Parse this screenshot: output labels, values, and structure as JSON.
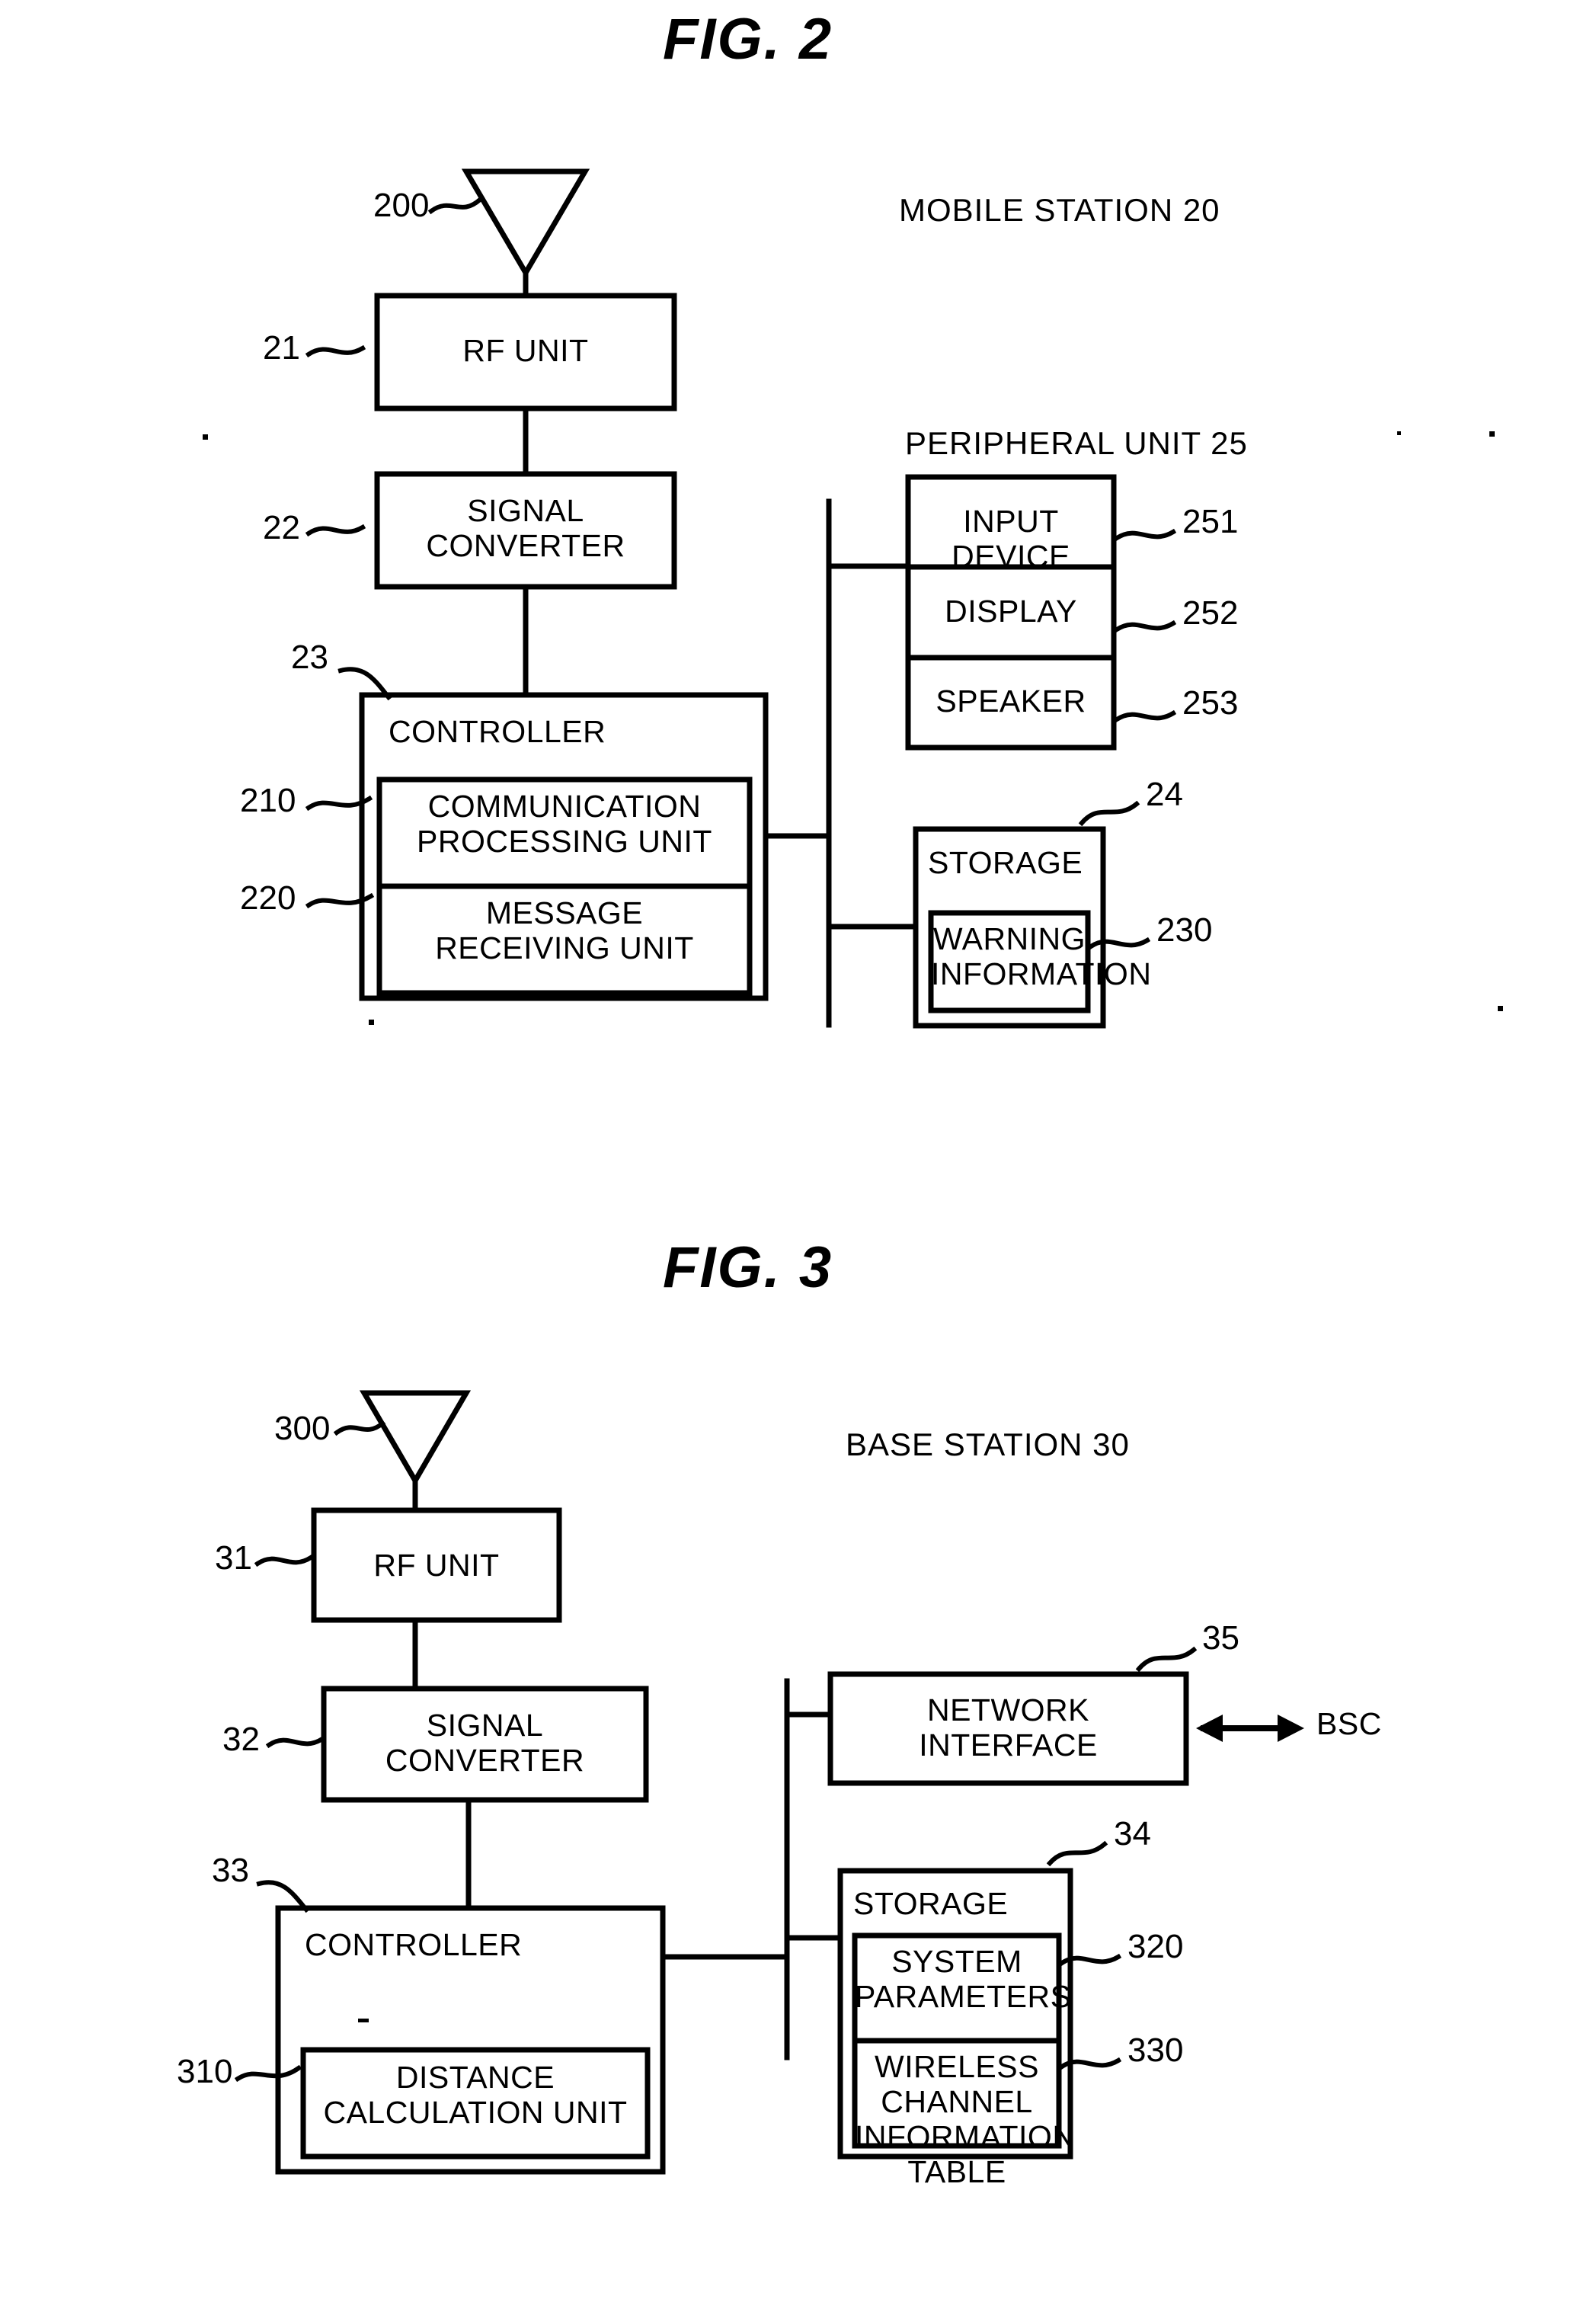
{
  "figures": [
    {
      "id": "fig2",
      "title": "FIG. 2",
      "section_title": "MOBILE STATION  20",
      "refs": {
        "antenna": "200",
        "rf_unit": "21",
        "signal_converter": "22",
        "controller": "23",
        "communication_processing_unit": "210",
        "message_receiving_unit": "220",
        "storage": "24",
        "warning_information": "230",
        "input_device": "251",
        "display": "252",
        "speaker": "253"
      },
      "blocks": {
        "rf_unit": "RF UNIT",
        "signal_converter": "SIGNAL\nCONVERTER",
        "controller": "CONTROLLER",
        "communication_processing_unit": "COMMUNICATION\nPROCESSING UNIT",
        "message_receiving_unit": "MESSAGE\nRECEIVING UNIT",
        "peripheral_unit_title": "PERIPHERAL UNIT  25",
        "input_device": "INPUT DEVICE",
        "display": "DISPLAY",
        "speaker": "SPEAKER",
        "storage": "STORAGE",
        "warning_information": "WARNING\nINFORMATION"
      }
    },
    {
      "id": "fig3",
      "title": "FIG. 3",
      "section_title": "BASE STATION  30",
      "refs": {
        "antenna": "300",
        "rf_unit": "31",
        "signal_converter": "32",
        "controller": "33",
        "distance_calculation_unit": "310",
        "network_interface": "35",
        "storage": "34",
        "system_parameters": "320",
        "wireless_channel_information_table": "330"
      },
      "blocks": {
        "rf_unit": "RF UNIT",
        "signal_converter": "SIGNAL\nCONVERTER",
        "controller": "CONTROLLER",
        "distance_calculation_unit": "DISTANCE\nCALCULATION UNIT",
        "network_interface": "NETWORK\nINTERFACE",
        "bsc": "BSC",
        "storage": "STORAGE",
        "system_parameters": "SYSTEM\nPARAMETERS",
        "wireless_channel_information_table": "WIRELESS CHANNEL\nINFORMATION TABLE"
      }
    }
  ],
  "style": {
    "ink": "#000000",
    "paper": "#ffffff"
  }
}
